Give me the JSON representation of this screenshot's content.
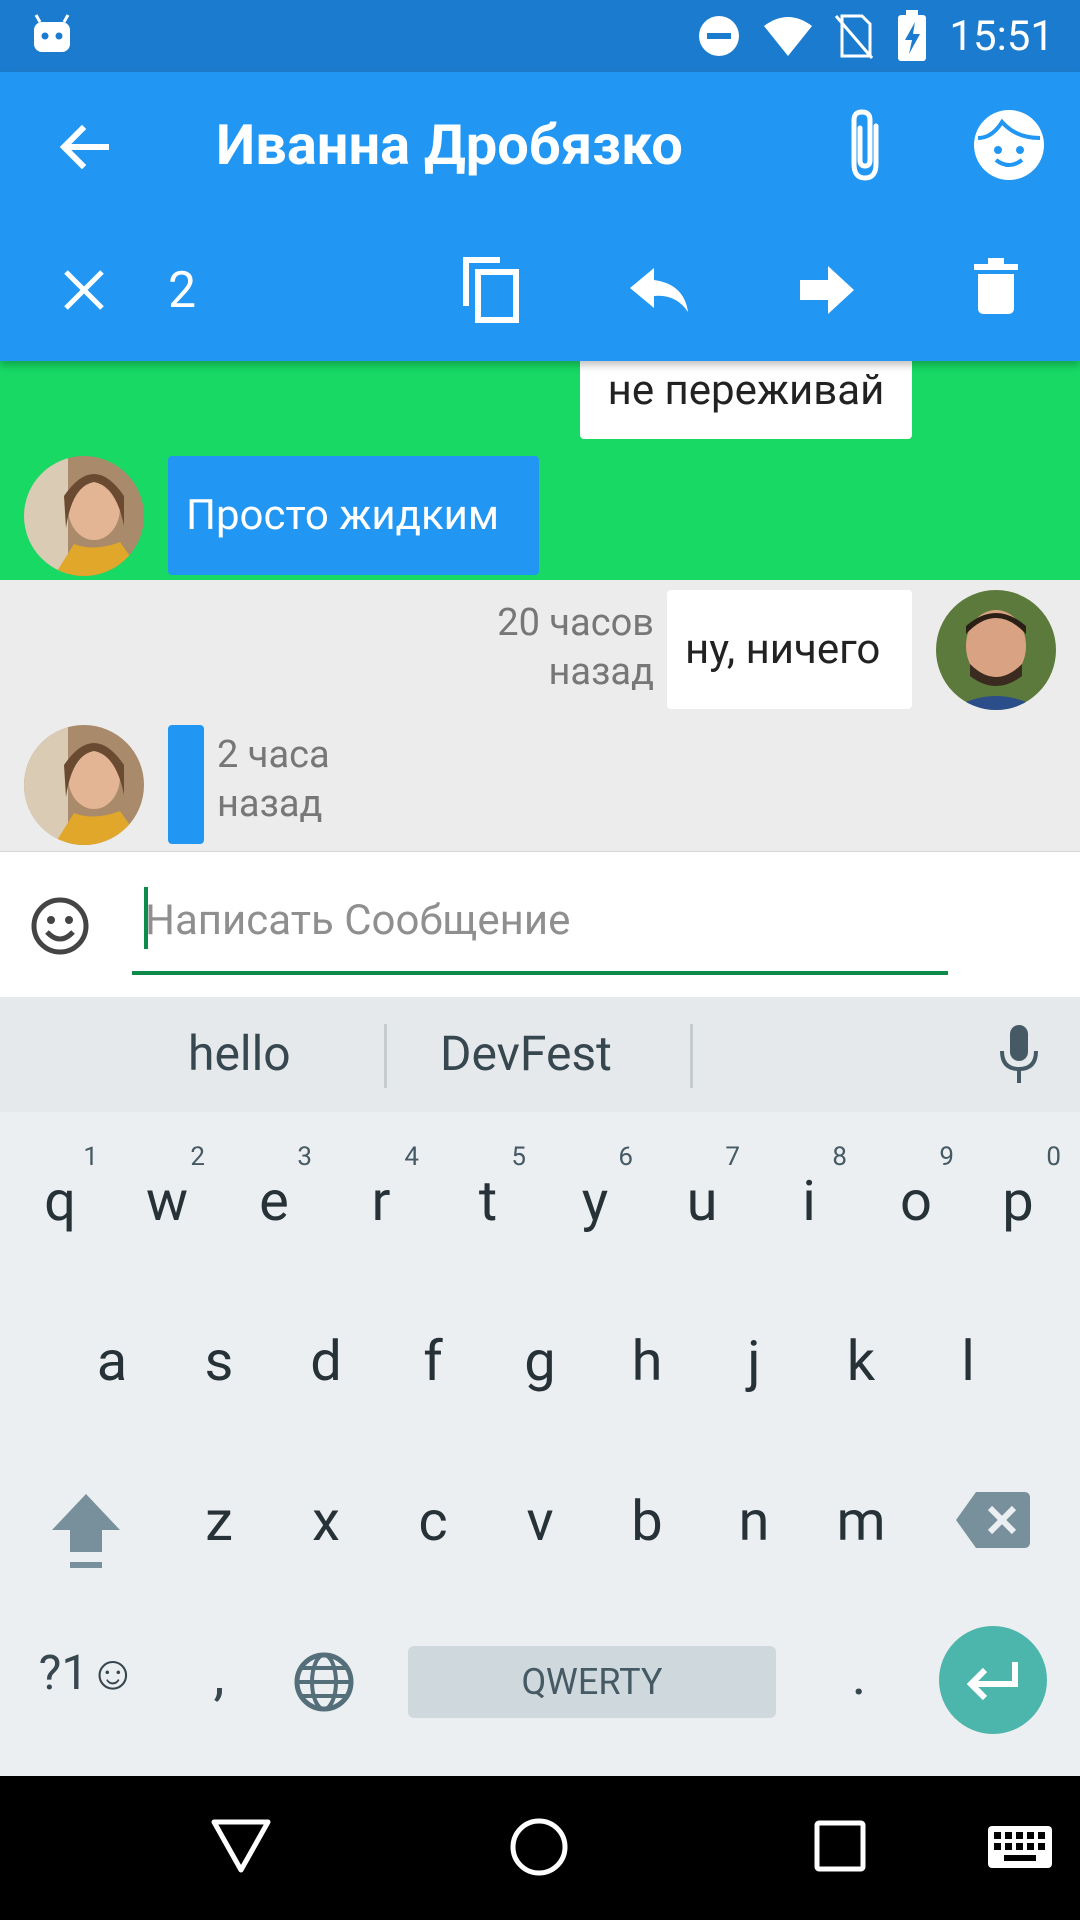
{
  "status_bar": {
    "time": "15:51"
  },
  "app_bar": {
    "title": "Иванна Дробязко",
    "selected_count": "2"
  },
  "messages": {
    "m1": {
      "text": "не переживай"
    },
    "m2": {
      "text": "Просто жидким"
    },
    "m3": {
      "text": "ну, ничего",
      "time_line1": "20 часов",
      "time_line2": "назад"
    },
    "m4": {
      "text": "",
      "time_line1": "2 часа",
      "time_line2": "назад"
    }
  },
  "composer": {
    "placeholder": "Написать Сообщение"
  },
  "keyboard": {
    "suggestions": [
      "hello",
      "DevFest"
    ],
    "row1": [
      "q",
      "w",
      "e",
      "r",
      "t",
      "y",
      "u",
      "i",
      "o",
      "p"
    ],
    "row1_numbers": [
      "1",
      "2",
      "3",
      "4",
      "5",
      "6",
      "7",
      "8",
      "9",
      "0"
    ],
    "row2": [
      "a",
      "s",
      "d",
      "f",
      "g",
      "h",
      "j",
      "k",
      "l"
    ],
    "row3": [
      "z",
      "x",
      "c",
      "v",
      "b",
      "n",
      "m"
    ],
    "symbols_label": "?1☺",
    "comma": ",",
    "space_label": "QWERTY",
    "period": "."
  },
  "colors": {
    "app_bar": "#2196f3",
    "status_bar": "#1b7ccf",
    "selection": "#17d964",
    "enter_key": "#4db6ac"
  }
}
